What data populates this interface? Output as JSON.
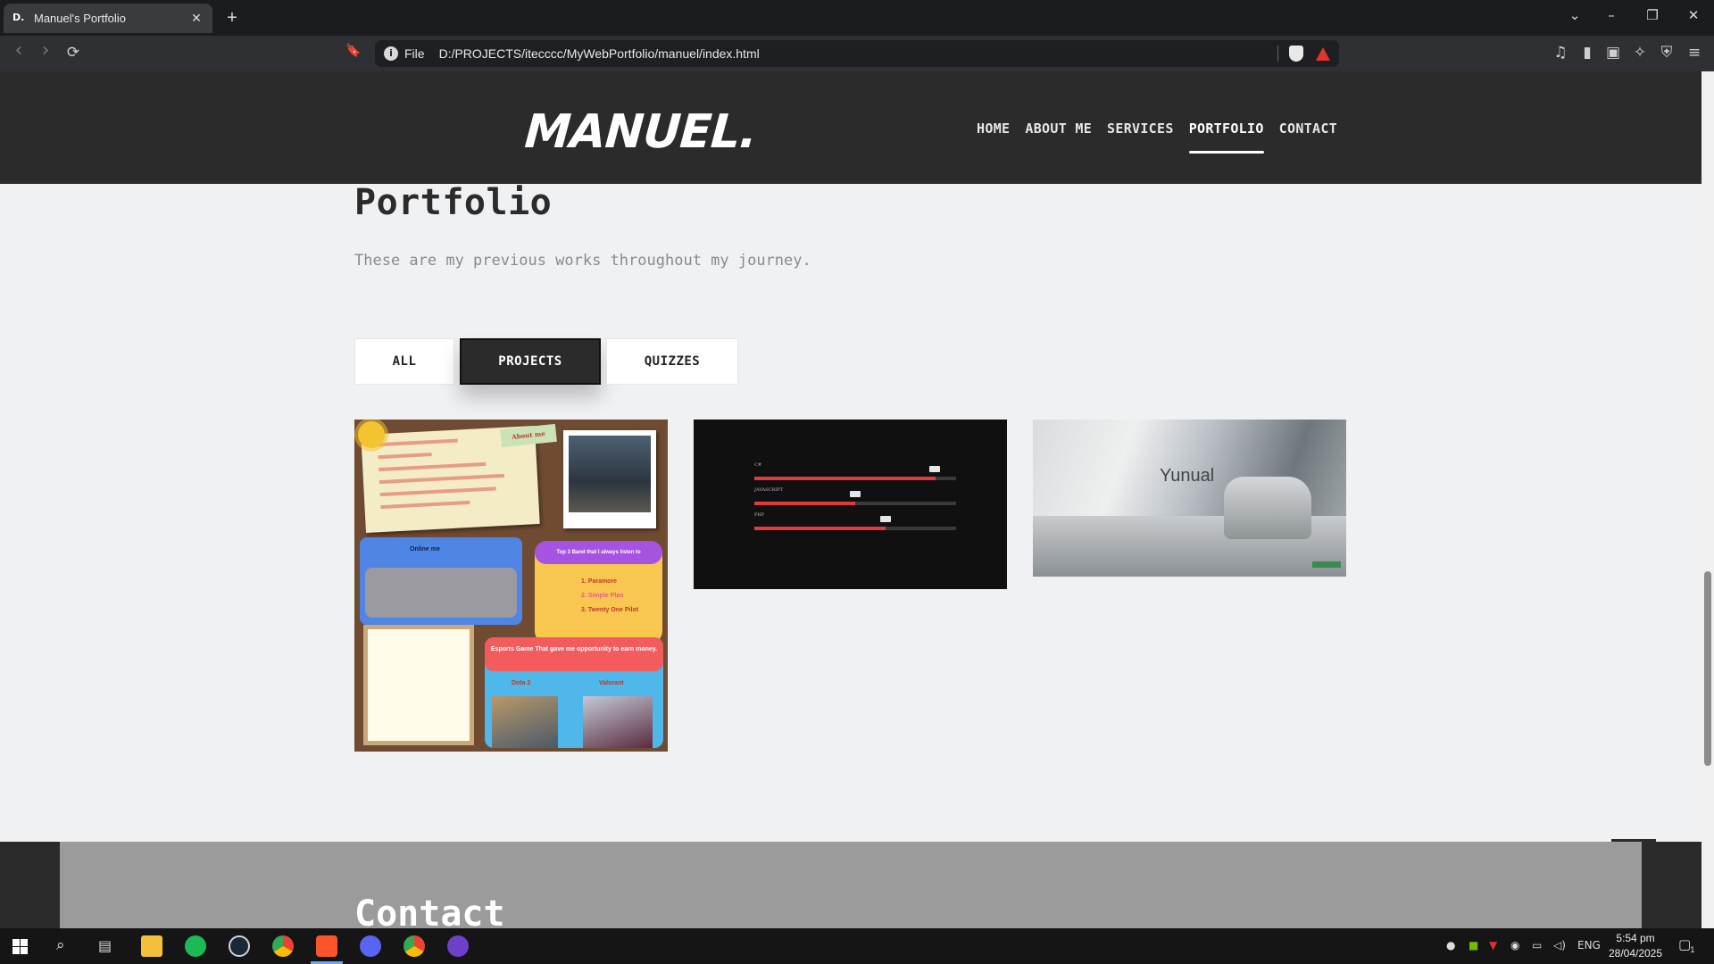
{
  "browser": {
    "tab_favicon": "D.",
    "tab_title": "Manuel's Portfolio",
    "tab_close": "✕",
    "new_tab": "+",
    "url_scheme": "File",
    "url": "D:/PROJECTS/itecccc/MyWebPortfolio/manuel/index.html",
    "window_controls": {
      "list": "⌄",
      "minimize": "–",
      "restore": "❐",
      "close": "✕"
    },
    "toolbar_icons": {
      "back": "‹",
      "forward": "›",
      "reload": "⟳",
      "bookmark": "🔖",
      "media": "♫",
      "sidebar": "▮",
      "wallet": "▣",
      "leo": "✧",
      "vpn": "⛨",
      "menu": "≡"
    }
  },
  "site": {
    "logo": "MANUEL.",
    "nav": [
      {
        "label": "HOME"
      },
      {
        "label": "ABOUT ME"
      },
      {
        "label": "SERVICES"
      },
      {
        "label": "PORTFOLIO",
        "active": true
      },
      {
        "label": "CONTACT"
      }
    ],
    "portfolio": {
      "title": "Portfolio",
      "subtitle": "These are my previous works throughout my journey.",
      "filters": [
        {
          "label": "ALL"
        },
        {
          "label": "PROJECTS",
          "active": true
        },
        {
          "label": "QUIZZES"
        }
      ],
      "cards": [
        {
          "name": "about-me-collage",
          "banner_text": "About me",
          "online_label": "Online me",
          "band_label": "Top 3 Band that I always listen to",
          "band_items": [
            "1. Paramore",
            "2. Simple Plan",
            "3. Twenty One Pilot"
          ],
          "esports_label": "Esports Game That gave me opportunity to earn money.",
          "games": [
            "Dota 2",
            "Valorant"
          ]
        },
        {
          "name": "skills-bars",
          "skills": [
            {
              "label": "C#",
              "value": 0.9
            },
            {
              "label": "JAVASCRIPT",
              "value": 0.5
            },
            {
              "label": "PHP",
              "value": 0.65
            }
          ]
        },
        {
          "name": "yunual-site",
          "headline": "Yunual"
        }
      ]
    },
    "contact_title": "Contact",
    "back_to_top": "^"
  },
  "taskbar": {
    "language": "ENG",
    "time": "5:54 pm",
    "date": "28/04/2025",
    "notification_count": "1"
  },
  "colors": {
    "header_bg": "#2b2b2b",
    "page_bg": "#f0f1f3",
    "skill_bar": "#e23b3b",
    "active_filter": "#2b2b2b"
  }
}
